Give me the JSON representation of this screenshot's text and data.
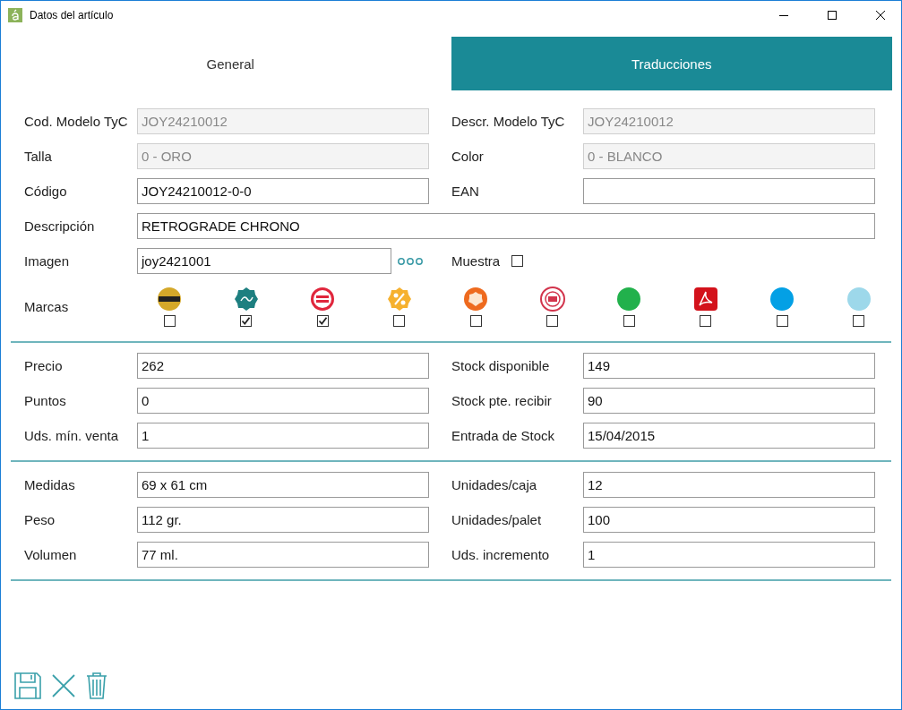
{
  "window": {
    "title": "Datos del artículo"
  },
  "tabs": [
    {
      "label": "General",
      "selected": false
    },
    {
      "label": "Traducciones",
      "selected": true
    }
  ],
  "rows": [
    {
      "kind": "pair",
      "left": {
        "label": "Cod. Modelo TyC",
        "value": "JOY24210012",
        "disabled": true
      },
      "right": {
        "label": "Descr. Modelo TyC",
        "value": "JOY24210012",
        "disabled": true
      }
    },
    {
      "kind": "pair",
      "left": {
        "label": "Talla",
        "value": "0 - ORO",
        "disabled": true
      },
      "right": {
        "label": "Color",
        "value": "0 - BLANCO",
        "disabled": true
      }
    },
    {
      "kind": "pair",
      "left": {
        "label": "Código",
        "value": "JOY24210012-0-0",
        "disabled": false
      },
      "right": {
        "label": "EAN",
        "disabled": false
      }
    },
    {
      "kind": "wide",
      "field": {
        "label": "Descripción",
        "value": "RETROGRADE CHRONO",
        "disabled": false
      }
    },
    {
      "kind": "image",
      "field": {
        "label": "Imagen",
        "value": "joy2421001",
        "disabled": false
      },
      "sample": {
        "label": "Muestra",
        "checked": false
      }
    },
    {
      "kind": "brands",
      "label": "Marcas",
      "brands": [
        {
          "kind": "best-choice",
          "color": "#d4a82a",
          "checked": false
        },
        {
          "kind": "sale",
          "color": "#1d7f80",
          "checked": true
        },
        {
          "kind": "best-seller",
          "color": "#e0263c",
          "checked": true
        },
        {
          "kind": "percent",
          "color": "#f6b12e",
          "checked": false
        },
        {
          "kind": "new",
          "color": "#ee6a1e",
          "checked": false
        },
        {
          "kind": "stamp",
          "color": "#d2344c",
          "checked": false
        },
        {
          "kind": "dot",
          "color": "#22b14c",
          "checked": false
        },
        {
          "kind": "pdf",
          "color": "#d3121b",
          "checked": false
        },
        {
          "kind": "dot",
          "color": "#03a0e5",
          "checked": false
        },
        {
          "kind": "dot",
          "color": "#9dd8ea",
          "checked": false
        }
      ]
    }
  ],
  "sections": [
    {
      "pairs": [
        {
          "left": {
            "label": "Precio",
            "value": "262"
          },
          "right": {
            "label": "Stock disponible",
            "value": "149"
          }
        },
        {
          "left": {
            "label": "Puntos",
            "value": "0"
          },
          "right": {
            "label": "Stock pte. recibir",
            "value": "90"
          }
        },
        {
          "left": {
            "label": "Uds. mín. venta",
            "value": "1"
          },
          "right": {
            "label": "Entrada de Stock",
            "value": "15/04/2015"
          }
        }
      ]
    },
    {
      "pairs": [
        {
          "left": {
            "label": "Medidas",
            "value": "69 x 61 cm"
          },
          "right": {
            "label": "Unidades/caja",
            "value": "12"
          }
        },
        {
          "left": {
            "label": "Peso",
            "value": "112 gr."
          },
          "right": {
            "label": "Unidades/palet",
            "value": "100"
          }
        },
        {
          "left": {
            "label": "Volumen",
            "value": "77 ml."
          },
          "right": {
            "label": "Uds. incremento",
            "value": "1"
          }
        }
      ]
    }
  ]
}
